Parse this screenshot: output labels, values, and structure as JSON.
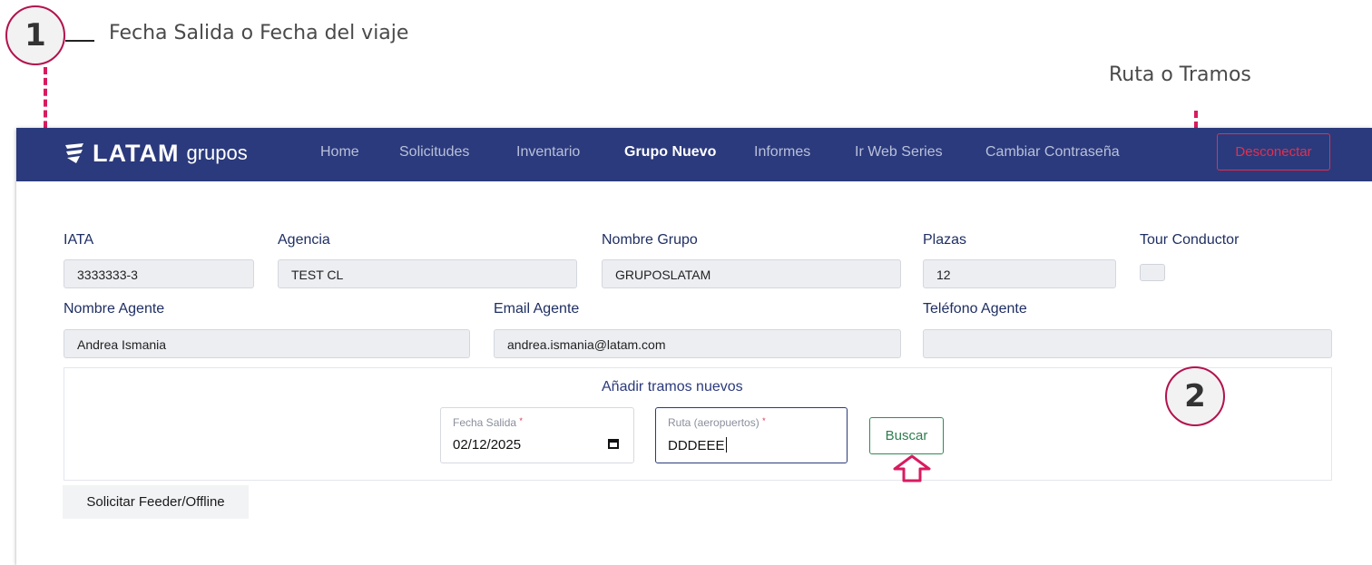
{
  "annotations": {
    "step1": {
      "number": "1",
      "text": "Fecha Salida o Fecha del viaje"
    },
    "step2": {
      "number": "2",
      "text": "Ruta  o Tramos"
    },
    "accent_color": "#d81b60"
  },
  "navbar": {
    "brand": {
      "name": "LATAM",
      "sub": "grupos"
    },
    "items": [
      {
        "label": "Home"
      },
      {
        "label": "Solicitudes"
      },
      {
        "label": "Inventario"
      },
      {
        "label": "Grupo Nuevo",
        "active": true
      },
      {
        "label": "Informes"
      },
      {
        "label": "Ir Web Series"
      },
      {
        "label": "Cambiar Contraseña"
      }
    ],
    "logout_label": "Desconectar",
    "background": "#2b3a7c"
  },
  "form": {
    "iata": {
      "label": "IATA",
      "value": "3333333-3"
    },
    "agencia": {
      "label": "Agencia",
      "value": "TEST CL"
    },
    "nombre_grupo": {
      "label": "Nombre Grupo",
      "value": "GRUPOSLATAM"
    },
    "plazas": {
      "label": "Plazas",
      "value": "12"
    },
    "tour_conductor": {
      "label": "Tour Conductor",
      "checked": false
    },
    "nombre_agente": {
      "label": "Nombre Agente",
      "value": "Andrea Ismania"
    },
    "email_agente": {
      "label": "Email Agente",
      "value": "andrea.ismania@latam.com"
    },
    "telefono_agente": {
      "label": "Teléfono Agente",
      "value": ""
    }
  },
  "segments": {
    "title": "Añadir tramos nuevos",
    "fecha_salida": {
      "label": "Fecha Salida",
      "required_mark": "*",
      "value": "02/12/2025"
    },
    "ruta": {
      "label": "Ruta (aeropuertos)",
      "required_mark": "*",
      "value": "DDDEEE"
    },
    "search_label": "Buscar"
  },
  "feeder_label": "Solicitar Feeder/Offline"
}
